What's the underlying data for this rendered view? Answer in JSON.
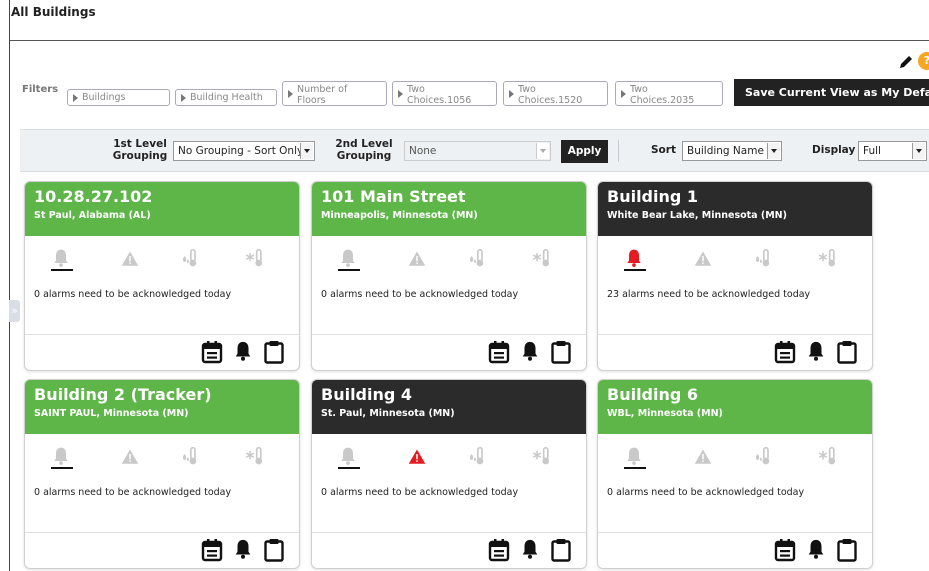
{
  "page": {
    "title": "All Buildings"
  },
  "filters": {
    "label": "Filters",
    "chips": [
      {
        "line1": "Buildings",
        "line2": ""
      },
      {
        "line1": "Building Health",
        "line2": ""
      },
      {
        "line1": "Number of",
        "line2": "Floors"
      },
      {
        "line1": "Two",
        "line2": "Choices.1056"
      },
      {
        "line1": "Two",
        "line2": "Choices.1520"
      },
      {
        "line1": "Two",
        "line2": "Choices.2035"
      }
    ],
    "save_view_label": "Save Current View as My Default",
    "help_label": "?"
  },
  "toolbar": {
    "first_level_label": "1st Level Grouping",
    "first_level_value": "No Grouping - Sort Only",
    "second_level_label": "2nd Level Grouping",
    "second_level_value": "None",
    "apply_label": "Apply",
    "sort_label": "Sort",
    "sort_value": "Building Name",
    "display_label": "Display",
    "display_value": "Full"
  },
  "colors": {
    "green": "#5eb548",
    "dark": "#2b2b2b",
    "alarm_red": "#e31b23",
    "icon_grey": "#c9c9c9"
  },
  "icons": {
    "bell": "bell-icon",
    "warning": "warning-icon",
    "thermometer": "thermometer-icon",
    "snowflake": "snowflake-thermometer-icon",
    "calendar": "calendar-icon",
    "alarm_bell": "alarm-bell-icon",
    "clipboard": "clipboard-icon"
  },
  "buildings": [
    {
      "name": "10.28.27.102",
      "location": "St Paul, Alabama (AL)",
      "status": "green",
      "alarms": "0 alarms need to be acknowledged today",
      "bell_active": false,
      "warning_active": false
    },
    {
      "name": "101 Main Street",
      "location": "Minneapolis, Minnesota (MN)",
      "status": "green",
      "alarms": "0 alarms need to be acknowledged today",
      "bell_active": false,
      "warning_active": false
    },
    {
      "name": "Building 1",
      "location": "White Bear Lake, Minnesota (MN)",
      "status": "dark",
      "alarms": "23 alarms need to be acknowledged today",
      "bell_active": true,
      "warning_active": false
    },
    {
      "name": "Building 2 (Tracker)",
      "location": "SAINT PAUL, Minnesota (MN)",
      "status": "green",
      "alarms": "0 alarms need to be acknowledged today",
      "bell_active": false,
      "warning_active": false
    },
    {
      "name": "Building 4",
      "location": "St. Paul, Minnesota (MN)",
      "status": "dark",
      "alarms": "0 alarms need to be acknowledged today",
      "bell_active": false,
      "warning_active": true
    },
    {
      "name": "Building 6",
      "location": "WBL, Minnesota (MN)",
      "status": "green",
      "alarms": "0 alarms need to be acknowledged today",
      "bell_active": false,
      "warning_active": false
    }
  ]
}
